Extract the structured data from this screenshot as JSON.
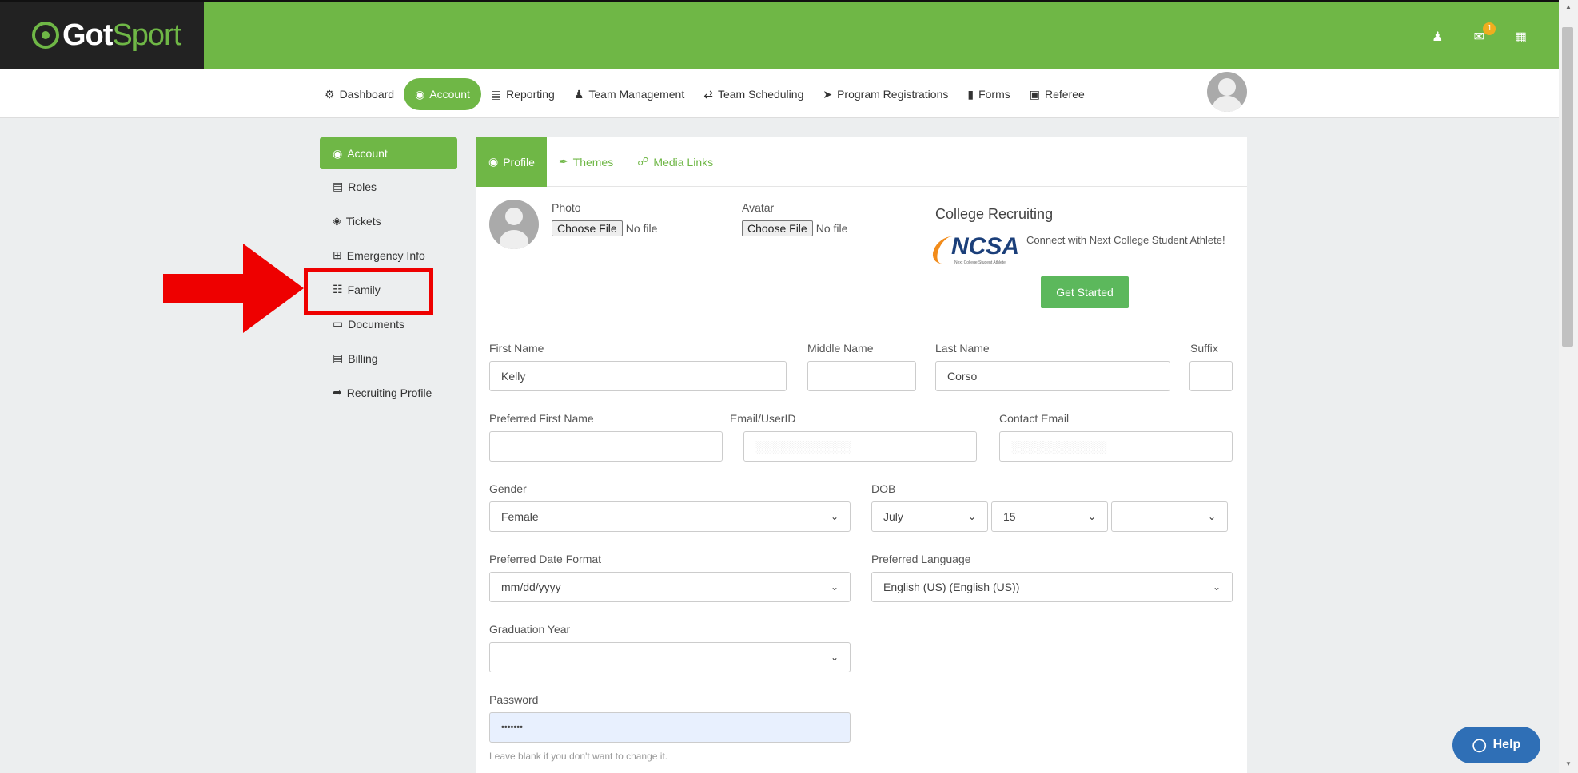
{
  "brand": {
    "logo_part1": "Got",
    "logo_part2": "Sport"
  },
  "topbar": {
    "notification_count": "1"
  },
  "nav": {
    "items": [
      {
        "label": "Dashboard",
        "icon": "tachometer-icon"
      },
      {
        "label": "Account",
        "icon": "user-circle-icon",
        "active": true
      },
      {
        "label": "Reporting",
        "icon": "file-icon"
      },
      {
        "label": "Team Management",
        "icon": "users-icon"
      },
      {
        "label": "Team Scheduling",
        "icon": "exchange-icon"
      },
      {
        "label": "Program Registrations",
        "icon": "paper-plane-icon"
      },
      {
        "label": "Forms",
        "icon": "file-solid-icon"
      },
      {
        "label": "Referee",
        "icon": "calendar-icon"
      }
    ]
  },
  "sidebar": {
    "items": [
      {
        "label": "Account",
        "icon": "user-circle-icon",
        "active": true
      },
      {
        "label": "Roles",
        "icon": "id-card-icon"
      },
      {
        "label": "Tickets",
        "icon": "ticket-icon"
      },
      {
        "label": "Emergency Info",
        "icon": "plus-square-icon"
      },
      {
        "label": "Family",
        "icon": "sitemap-icon"
      },
      {
        "label": "Documents",
        "icon": "folder-open-icon"
      },
      {
        "label": "Billing",
        "icon": "credit-card-icon"
      },
      {
        "label": "Recruiting Profile",
        "icon": "share-icon"
      }
    ]
  },
  "tabs": [
    {
      "label": "Profile",
      "icon": "user-circle-icon",
      "active": true
    },
    {
      "label": "Themes",
      "icon": "paint-brush-icon"
    },
    {
      "label": "Media Links",
      "icon": "link-icon"
    }
  ],
  "upload": {
    "photo_label": "Photo",
    "avatar_label": "Avatar",
    "choose_file": "Choose File",
    "no_file": "No file"
  },
  "recruiting": {
    "title": "College Recruiting",
    "logo_text": "NCSA",
    "logo_tagline": "Next College Student Athlete",
    "text": "Connect with Next College Student Athlete!",
    "button": "Get Started"
  },
  "form": {
    "first_name_label": "First Name",
    "first_name_value": "Kelly",
    "middle_name_label": "Middle Name",
    "middle_name_value": "",
    "last_name_label": "Last Name",
    "last_name_value": "Corso",
    "suffix_label": "Suffix",
    "suffix_value": "",
    "preferred_first_name_label": "Preferred First Name",
    "preferred_first_name_value": "",
    "email_label": "Email/UserID",
    "contact_email_label": "Contact Email",
    "gender_label": "Gender",
    "gender_value": "Female",
    "dob_label": "DOB",
    "dob_month": "July",
    "dob_day": "15",
    "dob_year": "",
    "date_format_label": "Preferred Date Format",
    "date_format_value": "mm/dd/yyyy",
    "language_label": "Preferred Language",
    "language_value": "English (US) (English (US))",
    "grad_year_label": "Graduation Year",
    "grad_year_value": "",
    "password_label": "Password",
    "password_value": "•••••••",
    "password_help": "Leave blank if you don't want to change it."
  },
  "help": {
    "label": "Help"
  }
}
